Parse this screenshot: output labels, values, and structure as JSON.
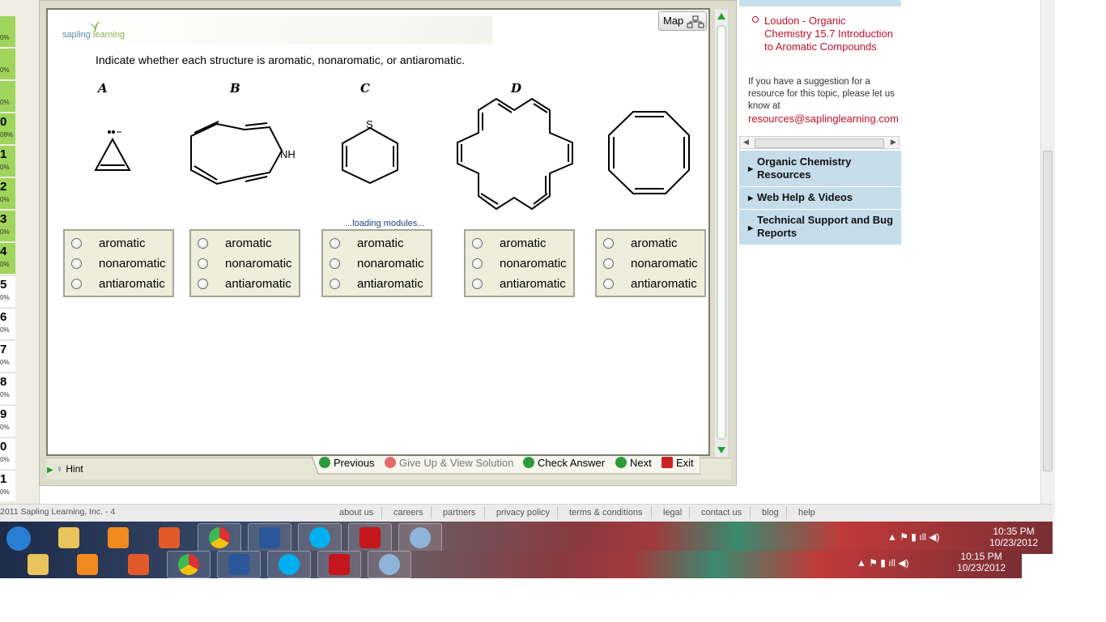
{
  "left_questions": [
    {
      "num": "",
      "pct": "0%"
    },
    {
      "num": "",
      "pct": "0%"
    },
    {
      "num": "",
      "pct": "0%"
    },
    {
      "num": "0",
      "pct": "08%"
    },
    {
      "num": "1",
      "pct": "0%"
    },
    {
      "num": "2",
      "pct": "0%"
    },
    {
      "num": "3",
      "pct": "0%"
    },
    {
      "num": "4",
      "pct": "0%"
    },
    {
      "num": "5",
      "pct": "0%"
    },
    {
      "num": "6",
      "pct": "0%"
    },
    {
      "num": "7",
      "pct": "0%"
    },
    {
      "num": "8",
      "pct": "0%"
    },
    {
      "num": "9",
      "pct": "0%"
    },
    {
      "num": "0",
      "pct": "0%"
    },
    {
      "num": "1",
      "pct": "0%"
    }
  ],
  "logo": {
    "text_a": "sapling",
    "text_b": "learning"
  },
  "map_button": "Map",
  "question": {
    "prompt": "Indicate whether each structure is aromatic, nonaromatic, or antiaromatic.",
    "letters": [
      "A",
      "B",
      "C",
      "D"
    ],
    "atom_labels": {
      "nh": "NH",
      "s": "S"
    },
    "loading": "...loading modules...",
    "options": [
      "aromatic",
      "nonaromatic",
      "antiaromatic"
    ]
  },
  "bottom_bar": {
    "hint": "Hint",
    "previous": "Previous",
    "give_up": "Give Up & View Solution",
    "check": "Check Answer",
    "next": "Next",
    "exit": "Exit"
  },
  "right_panel": {
    "resource_link": "Loudon - Organic Chemistry 15.7 Introduction to Aromatic Compounds",
    "suggestion": "If you have a suggestion for a resource for this topic, please let us know at",
    "email": "resources@saplinglearning.com",
    "sections": [
      "Organic Chemistry Resources",
      "Web Help & Videos",
      "Technical Support and Bug Reports"
    ]
  },
  "footer": {
    "copyright": "2011 Sapling Learning, Inc. - 4",
    "links": [
      "about us",
      "careers",
      "partners",
      "privacy policy",
      "terms & conditions",
      "legal",
      "contact us",
      "blog",
      "help"
    ]
  },
  "taskbar_top": {
    "time": "10:35 PM",
    "date": "10/23/2012"
  },
  "taskbar_bottom": {
    "time": "10:15 PM",
    "date": "10/23/2012"
  },
  "colors": {
    "accent_link": "#c0102a",
    "accordion": "#c5dceb",
    "option_bg": "#eeeedc"
  }
}
